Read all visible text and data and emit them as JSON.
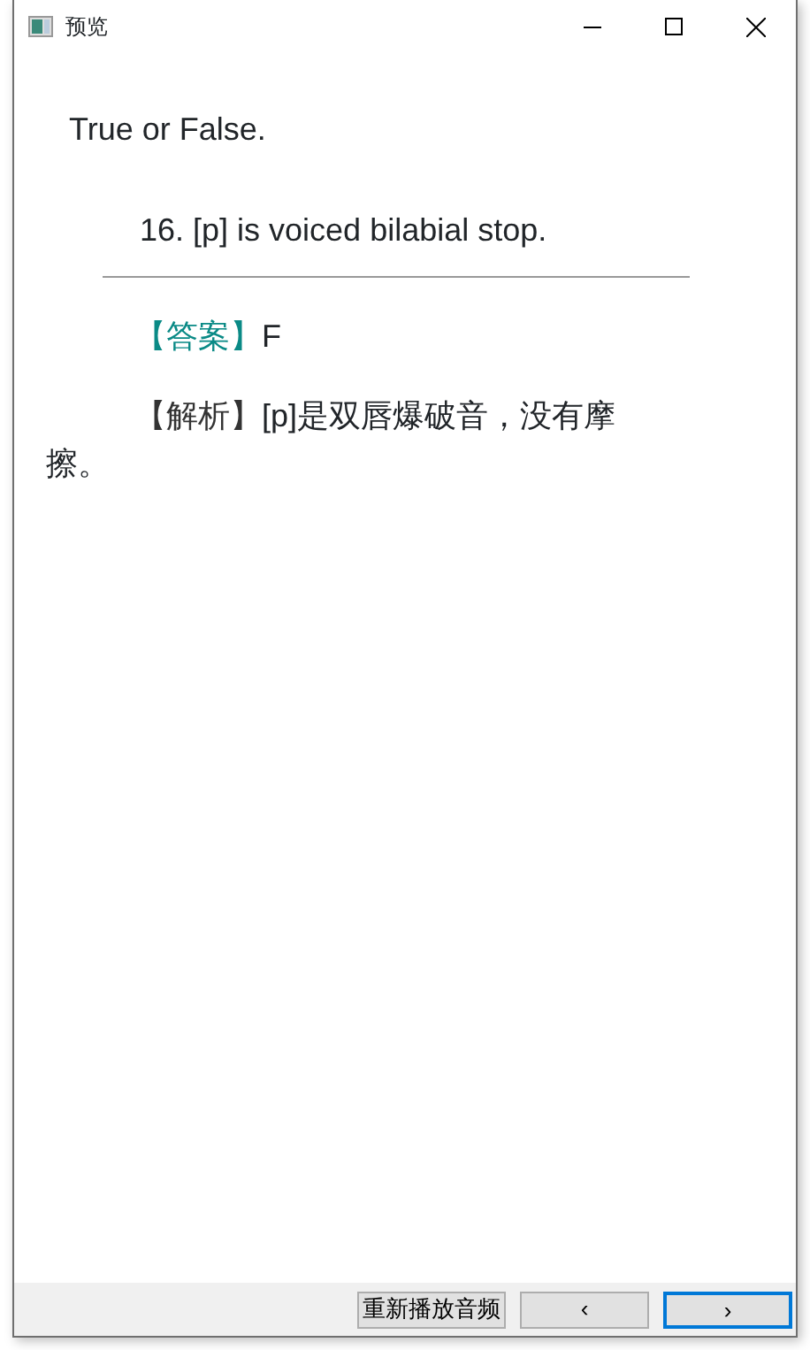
{
  "window": {
    "title": "预览"
  },
  "question": {
    "heading": "True or False.",
    "text": "16. [p] is voiced bilabial stop."
  },
  "answer": {
    "label": "【答案】",
    "value": "F"
  },
  "analysis": {
    "label": "【解析】",
    "text": "[p]是双唇爆破音，没有摩擦。"
  },
  "buttons": [
    {
      "kind": "replay",
      "label": "重新播放音频",
      "focused": false
    },
    {
      "kind": "prev",
      "label": "‹",
      "focused": false
    },
    {
      "kind": "next",
      "label": "›",
      "focused": true
    }
  ]
}
